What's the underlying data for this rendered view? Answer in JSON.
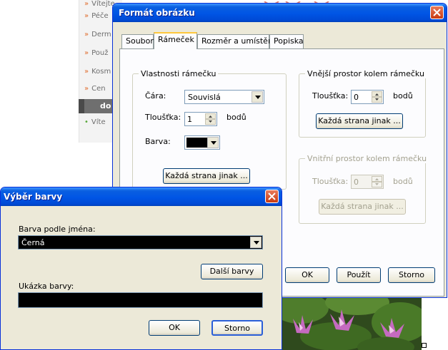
{
  "background": {
    "nav_items": [
      {
        "label": "Vítejte",
        "bullet": "»"
      },
      {
        "label": "Péče",
        "bullet": "»"
      },
      {
        "label": "Derm",
        "bullet": "»"
      },
      {
        "label": "Použ",
        "bullet": "»"
      },
      {
        "label": "Kosm",
        "bullet": "»"
      },
      {
        "label": "Cen",
        "bullet": "»"
      },
      {
        "label": "Víte",
        "bullet": "•"
      }
    ],
    "nav_active": "do"
  },
  "format_dialog": {
    "title": "Formát obrázku",
    "tabs": [
      {
        "label": "Soubor"
      },
      {
        "label": "Rámeček"
      },
      {
        "label": "Rozměr a umístění"
      },
      {
        "label": "Popiska"
      }
    ],
    "border_props": {
      "group_label": "Vlastnosti rámečku",
      "line_label": "Čára:",
      "line_value": "Souvislá",
      "thickness_label": "Tloušťka:",
      "thickness_value": "1",
      "thickness_unit": "bodů",
      "color_label": "Barva:",
      "color_value": "#000000",
      "each_side_button": "Každá strana jinak ..."
    },
    "outer_space": {
      "group_label": "Vnější prostor kolem rámečku",
      "thickness_label": "Tloušťka:",
      "thickness_value": "0",
      "unit": "bodů",
      "each_side_button": "Každá strana jinak ..."
    },
    "inner_space": {
      "group_label": "Vnitřní prostor kolem rámečku",
      "thickness_label": "Tloušťka:",
      "thickness_value": "0",
      "unit": "bodů",
      "each_side_button": "Každá strana jinak ..."
    },
    "buttons": {
      "ok": "OK",
      "apply": "Použít",
      "cancel": "Storno"
    }
  },
  "color_dialog": {
    "title": "Výběr barvy",
    "name_label": "Barva podle jména:",
    "name_value": "Černá",
    "more_colors_button": "Další barvy",
    "preview_label": "Ukázka barvy:",
    "preview_color": "#000000",
    "buttons": {
      "ok": "OK",
      "cancel": "Storno"
    }
  },
  "colors": {
    "titlebar": "#0055e5",
    "dialog_bg": "#ece9d8",
    "nav_bullet": "#e06a2a"
  }
}
